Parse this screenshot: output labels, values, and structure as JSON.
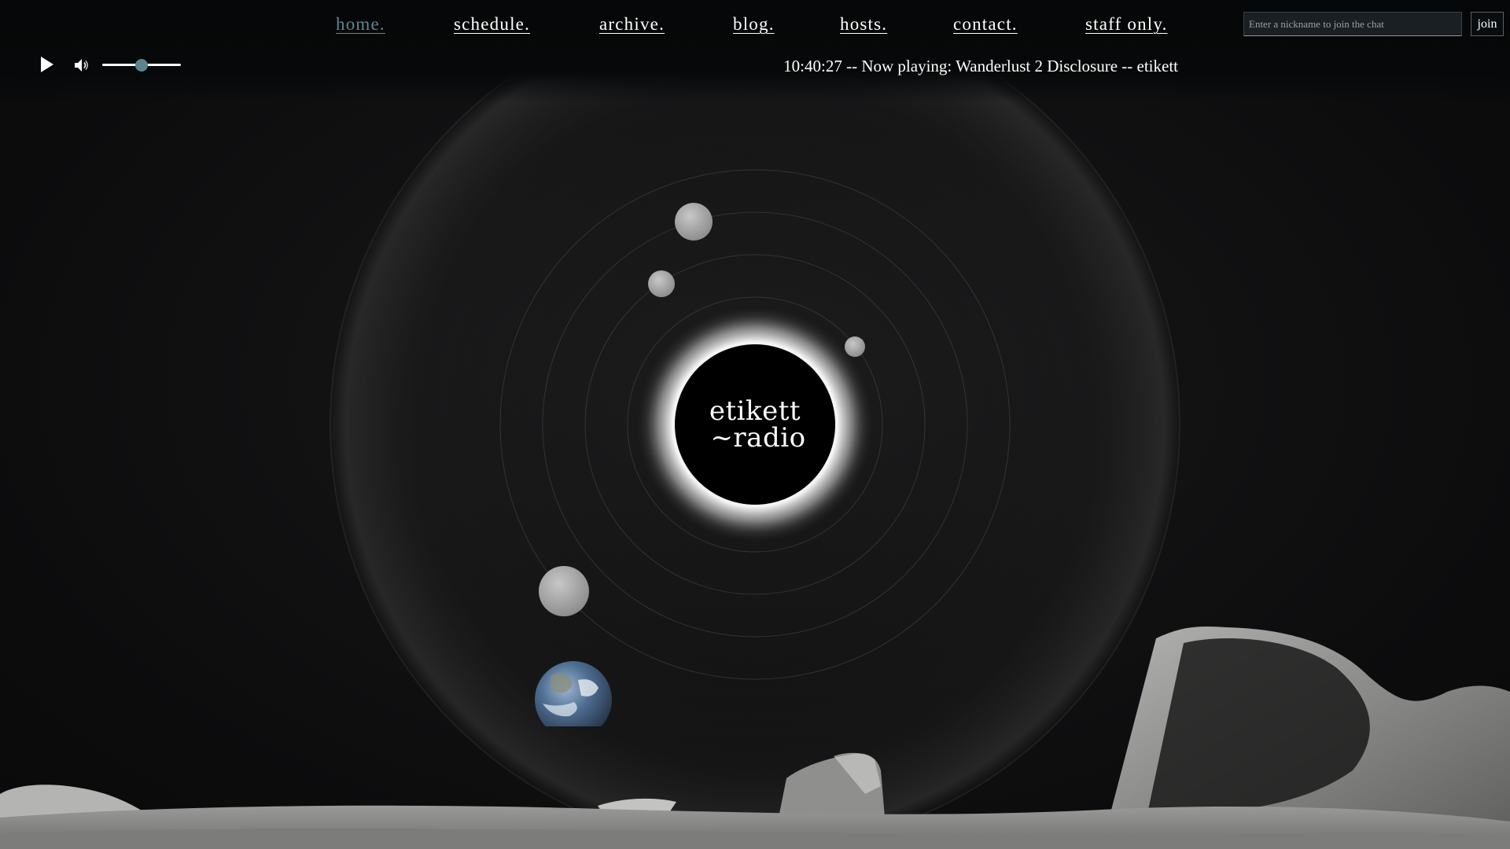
{
  "nav": {
    "items": [
      {
        "label": "home.",
        "active": true
      },
      {
        "label": "schedule.",
        "active": false
      },
      {
        "label": "archive.",
        "active": false
      },
      {
        "label": "blog.",
        "active": false
      },
      {
        "label": "hosts.",
        "active": false
      },
      {
        "label": "contact.",
        "active": false
      },
      {
        "label": "staff only.",
        "active": false
      }
    ]
  },
  "chat": {
    "placeholder": "Enter a nickname to join the chat",
    "value": "",
    "join_label": "join"
  },
  "player": {
    "play_icon": "play-icon",
    "volume_icon": "volume-icon",
    "volume_level": 0.5,
    "now_playing": "10:40:27 -- Now playing: Wanderlust 2 Disclosure -- etikett"
  },
  "logo": {
    "line1": "etikett",
    "line2": "~radio"
  },
  "colors": {
    "accent": "#5a8590",
    "active_nav": "#5c8790",
    "background": "#0b0b0c",
    "text": "#ffffff"
  }
}
